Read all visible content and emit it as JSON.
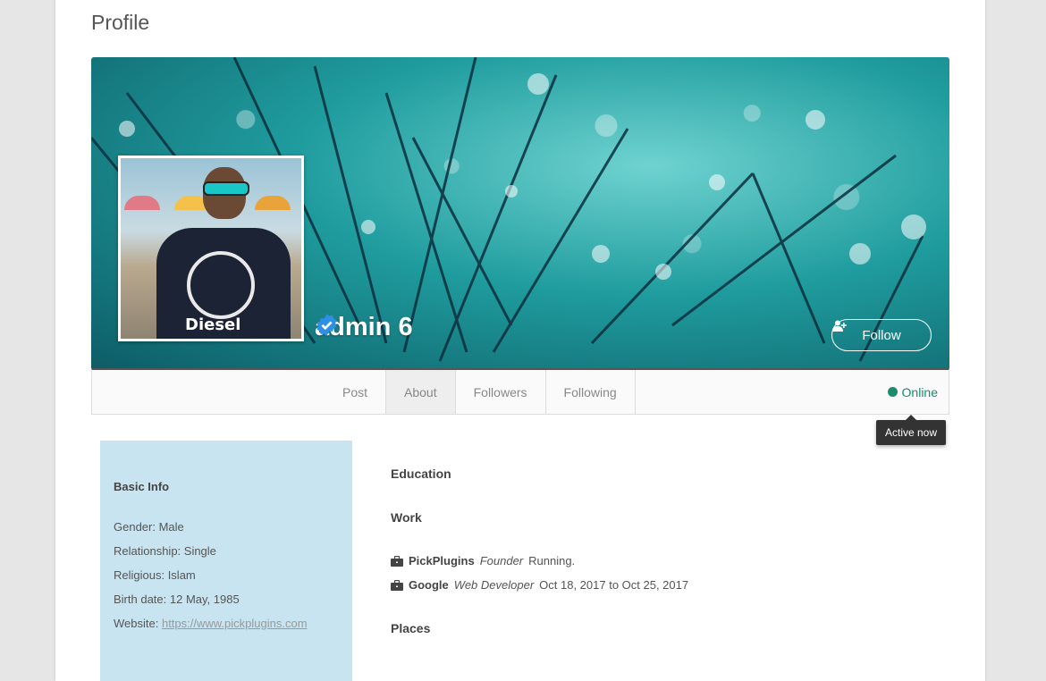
{
  "page_title": "Profile",
  "user": {
    "name": "admin 6",
    "verified": true,
    "follow_label": "Follow",
    "avatar_shirt_text": "Diesel"
  },
  "tabs": [
    {
      "label": "Post"
    },
    {
      "label": "About",
      "active": true
    },
    {
      "label": "Followers"
    },
    {
      "label": "Following"
    }
  ],
  "status": {
    "label": "Online",
    "tooltip": "Active now",
    "color": "#1a8c6e"
  },
  "basic_info": {
    "heading": "Basic Info",
    "gender": "Gender: Male",
    "relationship": "Relationship: Single",
    "religious": "Religious: Islam",
    "birth_date": "Birth date: 12 May, 1985",
    "website_label": "Website:",
    "website_url": "https://www.pickplugins.com"
  },
  "sections": {
    "education": "Education",
    "work": "Work",
    "places": "Places"
  },
  "work": [
    {
      "company": "PickPlugins",
      "role": "Founder",
      "period": "Running."
    },
    {
      "company": "Google",
      "role": "Web Developer",
      "period": "Oct 18, 2017 to Oct 25, 2017"
    }
  ],
  "colors": {
    "cover": "#1f9c9e",
    "basic_info_bg": "#c8e4f1",
    "verified": "#2e8fe6"
  }
}
